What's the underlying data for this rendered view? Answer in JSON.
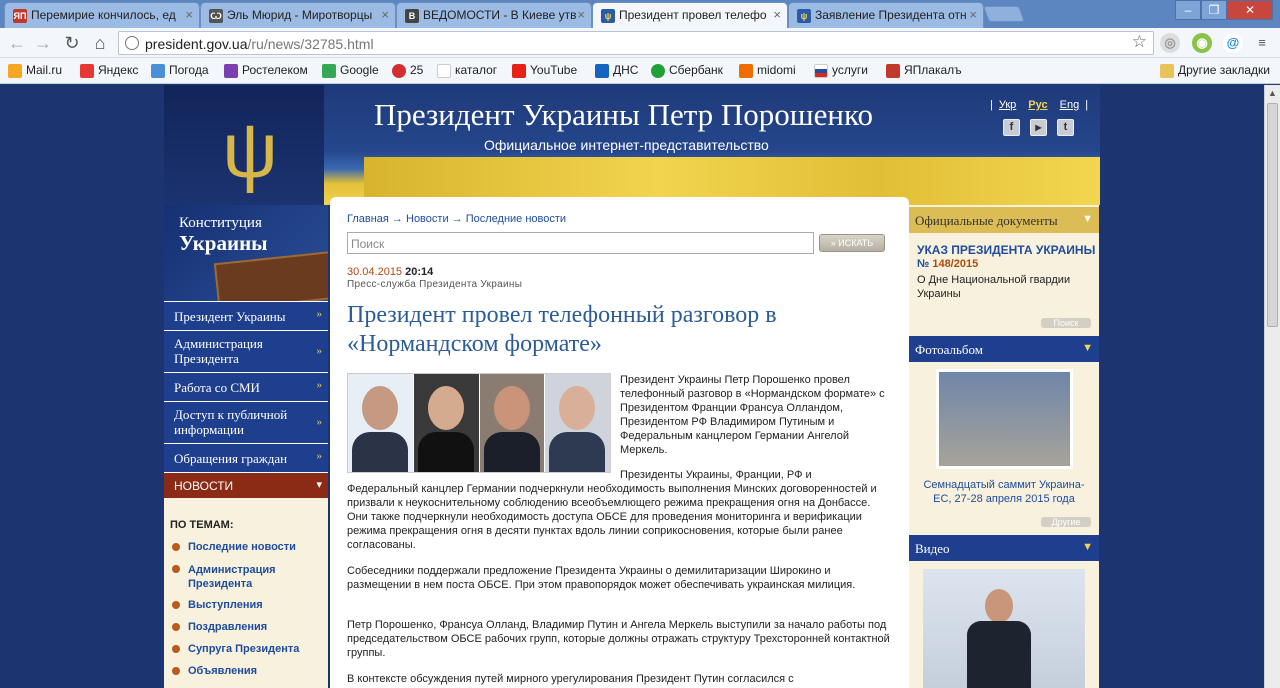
{
  "browser": {
    "tabs": [
      {
        "title": "Перемирие кончилось, ед",
        "favicon": "yap-icon",
        "color": "#c0392b"
      },
      {
        "title": "Эль Мюрид - Миротворцы",
        "favicon": "blog-icon",
        "color": "#555555"
      },
      {
        "title": "ВЕДОМОСТИ - В Киеве утв",
        "favicon": "vedomosti-icon",
        "color": "#444444"
      },
      {
        "title": "Президент провел телефо",
        "favicon": "ua-trident-icon",
        "color": "#2a5aa8"
      },
      {
        "title": "Заявление Президента отн",
        "favicon": "ua-trident-icon",
        "color": "#2a5aa8"
      }
    ],
    "url_host": "president.gov.ua",
    "url_path": "/ru/news/32785.html",
    "bookmarks": [
      {
        "label": "Mail.ru",
        "icon": "mailru-icon",
        "color": "#f5a623"
      },
      {
        "label": "Яндекс",
        "icon": "yandex-icon",
        "color": "#e53935"
      },
      {
        "label": "Погода",
        "icon": "weather-icon",
        "color": "#4a90d9"
      },
      {
        "label": "Ростелеком",
        "icon": "rostelecom-icon",
        "color": "#7b3fb0"
      },
      {
        "label": "Google",
        "icon": "google-maps-icon",
        "color": "#34a853"
      },
      {
        "label": "25",
        "icon": "counter-icon",
        "color": "#d32f2f"
      },
      {
        "label": "каталог",
        "icon": "page-icon",
        "color": "#ffffff"
      },
      {
        "label": "YouTube",
        "icon": "youtube-icon",
        "color": "#e62117"
      },
      {
        "label": "ДНС",
        "icon": "dns-icon",
        "color": "#1565c0"
      },
      {
        "label": "Сбербанк",
        "icon": "sberbank-icon",
        "color": "#21a038"
      },
      {
        "label": "midomi",
        "icon": "midomi-icon",
        "color": "#ef6c00"
      },
      {
        "label": "услуги",
        "icon": "russia-flag-icon",
        "color": "#1e4fa0"
      },
      {
        "label": "ЯПлакалъ",
        "icon": "yap-icon",
        "color": "#c0392b"
      }
    ],
    "other_bookmarks": "Другие закладки"
  },
  "site": {
    "title": "Президент Украины Петр Порошенко",
    "subtitle": "Официальное интернет-представительство",
    "langs": [
      "Укр",
      "Рус",
      "Eng"
    ],
    "social": [
      "f",
      "▶",
      "t"
    ]
  },
  "left": {
    "constitution_l1": "Конституция",
    "constitution_l2": "Украины",
    "menu": [
      "Президент Украины",
      "Администрация Президента",
      "Работа со СМИ",
      "Доступ к публичной информации",
      "Обращения граждан"
    ],
    "news": "НОВОСТИ",
    "topics_label": "ПО ТЕМАМ:",
    "topics": [
      "Последние новости",
      "Администрация Президента",
      "Выступления",
      "Поздравления",
      "Супруга Президента",
      "Объявления"
    ]
  },
  "article": {
    "breadcrumb": [
      "Главная",
      "Новости",
      "Последние новости"
    ],
    "search_placeholder": "Поиск",
    "search_button": "ИСКАТЬ",
    "date": "30.04.2015",
    "time": "20:14",
    "source": "Пресс-служба Президента Украины",
    "title": "Президент провел телефонный разговор в «Нормандском формате»",
    "p1": "Президент Украины Петр Порошенко провел телефонный разговор в «Нормандском формате» с Президентом Франции Франсуа Олландом, Президентом РФ Владимиром Путиным и Федеральным канцлером Германии Ангелой Меркель.",
    "p2a": "Президенты Украины, Франции, РФ и",
    "p2b": "Федеральный канцлер Германии подчеркнули необходимость выполнения Минских договоренностей и призвали к неукоснительному соблюдению всеобъемлющего режима прекращения огня на Донбассе. Они также подчеркнули необходимость доступа ОБСЕ для проведения мониторинга и верификации режима прекращения огня в десяти пунктах вдоль линии соприкосновения, которые были ранее согласованы.",
    "p3": "Собеседники поддержали предложение Президента Украины о демилитаризации Широкино и размещении в нем поста ОБСЕ. При этом правопорядок может обеспечивать украинская милиция.",
    "p4": "Петр Порошенко, Франсуа Олланд, Владимир Путин и Ангела Меркель выступили за начало работы под председательством ОБСЕ рабочих групп, которые должны отражать структуру Трехсторонней контактной группы.",
    "p5": "В контексте обсуждения путей мирного урегулирования Президент Путин согласился с"
  },
  "right": {
    "docs_header": "Официальные документы",
    "doc_title": "УКАЗ ПРЕЗИДЕНТА УКРАИНЫ",
    "doc_num_prefix": "№",
    "doc_num": "148/2015",
    "doc_desc": "О Дне Национальной гвардии Украины",
    "search_btn": "Поиск",
    "photo_header": "Фотоальбом",
    "photo_caption": "Семнадцатый саммит Украина-ЕС, 27-28 апреля 2015 года",
    "others_btn": "Другие",
    "video_header": "Видео"
  }
}
